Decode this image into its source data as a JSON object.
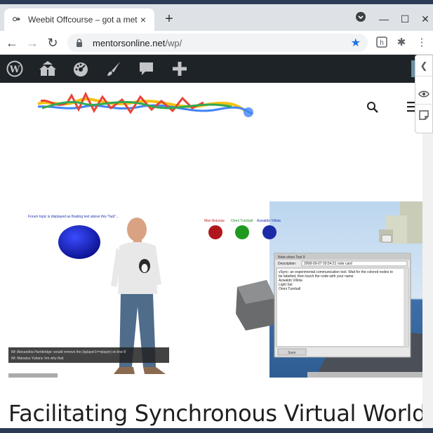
{
  "browser": {
    "tab_title": "Weebit Offcourse – got a metaverse?",
    "tab_close": "×",
    "new_tab": "+",
    "url_host": "mentorsonline.net",
    "url_path": "/wp/",
    "accent": "#1a73e8"
  },
  "wp_admin_bar": {
    "items": [
      "wordpress-logo-icon",
      "my-sites-icon",
      "dashboard-icon",
      "customize-brush-icon",
      "comments-icon",
      "new-content-plus-icon"
    ]
  },
  "site_header": {
    "logo_alt": "scribble logo",
    "search_icon": "search-icon",
    "menu_icon": "menu-icon"
  },
  "hero": {
    "caption_topic": "Forum topic is displayed as floating text above this \"hub\"...",
    "name_1": "Mari Asturias",
    "name_2": "Omni Turnball",
    "name_3": "Azwaldo Villota",
    "notecard_title": "Note-show Tool 9",
    "notecard_desc_label": "Description",
    "notecard_desc_value": "2008-09-07 03:54:21 note card",
    "notecard_text_1": "vSync: an experimental communication tool. Wait for the colored nodes to",
    "notecard_text_2": "be labelled, then touch the node with your name.",
    "notecard_text_3": "Azwaldo Villota",
    "notecard_text_4": "Light Sel",
    "notecard_text_5": "Omni Turnball",
    "notecard_save": "Save",
    "chat_line_1": "IM: Alexandria Humbridge: would remove the (kplayer1==player) on line 8",
    "chat_line_2": "IM: Manatsu Yuhara: hm why that"
  },
  "post": {
    "title": "Facilitating Synchronous Virtual World"
  }
}
